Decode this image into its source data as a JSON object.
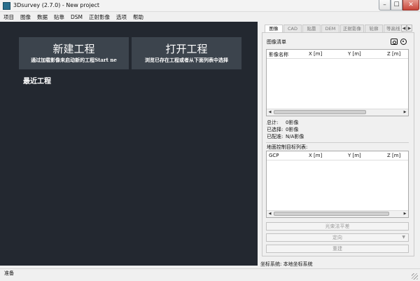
{
  "window": {
    "title": "3Dsurvey (2.7.0) - New project",
    "min": "–",
    "max": "☐",
    "close": "✕"
  },
  "menu": [
    "项目",
    "图像",
    "数据",
    "贴靠",
    "DSM",
    "正射影像",
    "选项",
    "帮助"
  ],
  "start": {
    "new_project_title": "新建工程",
    "new_project_sub": "通过加载影像来启动新的工程Start ne",
    "open_project_title": "打开工程",
    "open_project_sub": "浏览已存在工程或者从下面列表中选择",
    "recent_label": "最近工程"
  },
  "tabs": [
    "图像",
    "CAD",
    "贴靠",
    "DEM",
    "正射影像",
    "轮廓",
    "等高线"
  ],
  "images": {
    "list_title": "图像清单",
    "columns": [
      "影像名称",
      "X [m]",
      "Y [m]",
      "Z [m]"
    ]
  },
  "stats": [
    {
      "key": "总计:",
      "value": "0影像"
    },
    {
      "key": "已选择:",
      "value": "0影像"
    },
    {
      "key": "已配准:",
      "value": "N/A影像"
    }
  ],
  "gcp": {
    "title": "地面控制目标列表:",
    "columns": [
      "GCP",
      "X [m]",
      "Y [m]",
      "Z [m]"
    ]
  },
  "actions": {
    "bundle": "光束法平差",
    "orient": "定向",
    "rebuild": "重建"
  },
  "coord_system": {
    "label": "坐标系统:",
    "value": "本地坐标系统"
  },
  "status": "准备",
  "icons": [
    "app-icon",
    "camera-icon",
    "target-icon",
    "chevron-down-icon",
    "resize-grip-icon"
  ]
}
